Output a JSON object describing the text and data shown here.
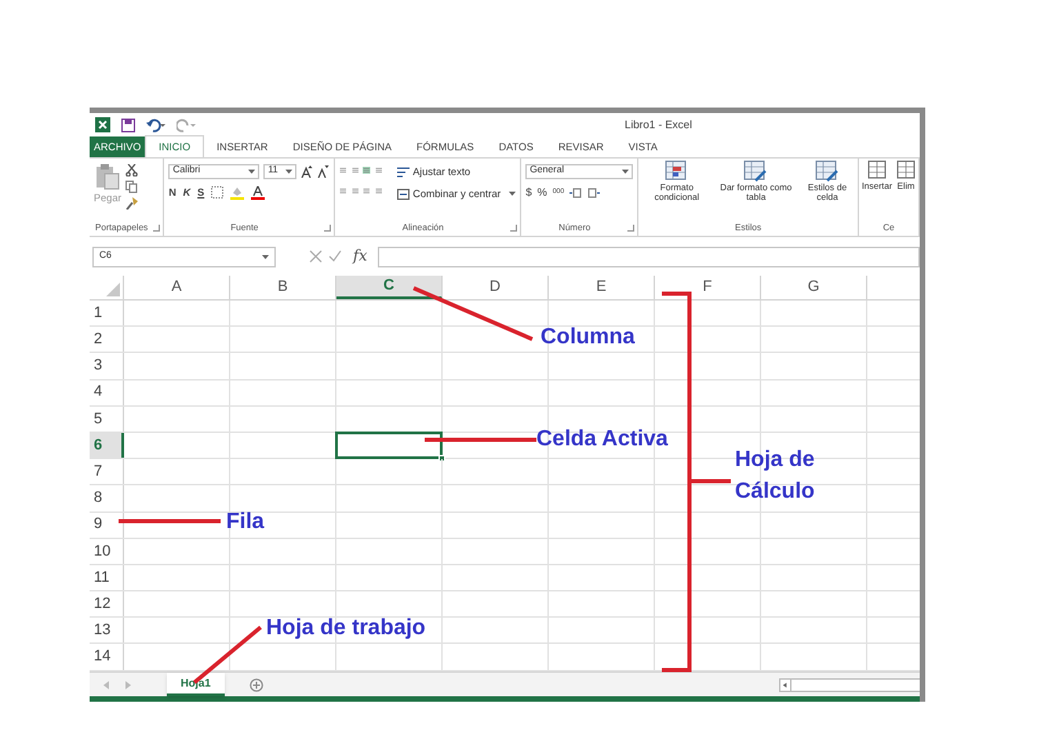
{
  "window": {
    "title": "Libro1 - Excel"
  },
  "ribbon_tabs": [
    {
      "label": "ARCHIVO",
      "kind": "file",
      "selected": false
    },
    {
      "label": "INICIO",
      "kind": "tab",
      "selected": true
    },
    {
      "label": "INSERTAR",
      "kind": "tab",
      "selected": false
    },
    {
      "label": "DISEÑO DE PÁGINA",
      "kind": "tab",
      "selected": false
    },
    {
      "label": "FÓRMULAS",
      "kind": "tab",
      "selected": false
    },
    {
      "label": "DATOS",
      "kind": "tab",
      "selected": false
    },
    {
      "label": "REVISAR",
      "kind": "tab",
      "selected": false
    },
    {
      "label": "VISTA",
      "kind": "tab",
      "selected": false
    }
  ],
  "ribbon": {
    "clipboard": {
      "label": "Portapapeles",
      "paste": "Pegar"
    },
    "font": {
      "label": "Fuente",
      "font_name": "Calibri",
      "font_size": "11",
      "bold": "N",
      "italic": "K",
      "underline": "S"
    },
    "alignment": {
      "label": "Alineación",
      "wrap": "Ajustar texto",
      "merge": "Combinar y centrar"
    },
    "number": {
      "label": "Número",
      "format": "General",
      "currency": "$",
      "percent": "%",
      "thousands": "000"
    },
    "styles": {
      "label": "Estilos",
      "buttons": [
        "Formato condicional",
        "Dar formato como tabla",
        "Estilos de celda"
      ]
    },
    "cells": {
      "label": "Ce",
      "buttons": [
        "Insertar",
        "Elim"
      ]
    }
  },
  "name_box": "C6",
  "formula_bar": {
    "function_label": "fx"
  },
  "columns": [
    {
      "label": "A",
      "selected": false
    },
    {
      "label": "B",
      "selected": false
    },
    {
      "label": "C",
      "selected": true
    },
    {
      "label": "D",
      "selected": false
    },
    {
      "label": "E",
      "selected": false
    },
    {
      "label": "F",
      "selected": false
    },
    {
      "label": "G",
      "selected": false
    }
  ],
  "rows": [
    {
      "label": "1",
      "selected": false
    },
    {
      "label": "2",
      "selected": false
    },
    {
      "label": "3",
      "selected": false
    },
    {
      "label": "4",
      "selected": false
    },
    {
      "label": "5",
      "selected": false
    },
    {
      "label": "6",
      "selected": true
    },
    {
      "label": "7",
      "selected": false
    },
    {
      "label": "8",
      "selected": false
    },
    {
      "label": "9",
      "selected": false
    },
    {
      "label": "10",
      "selected": false
    },
    {
      "label": "11",
      "selected": false
    },
    {
      "label": "12",
      "selected": false
    },
    {
      "label": "13",
      "selected": false
    },
    {
      "label": "14",
      "selected": false
    }
  ],
  "sheet_tabs": [
    {
      "label": "Hoja1",
      "selected": true
    }
  ],
  "annotations": [
    {
      "text": "Columna"
    },
    {
      "text": "Celda Activa"
    },
    {
      "text": "Hoja de Cálculo"
    },
    {
      "text": "Fila"
    },
    {
      "text": "Hoja de trabajo"
    }
  ]
}
